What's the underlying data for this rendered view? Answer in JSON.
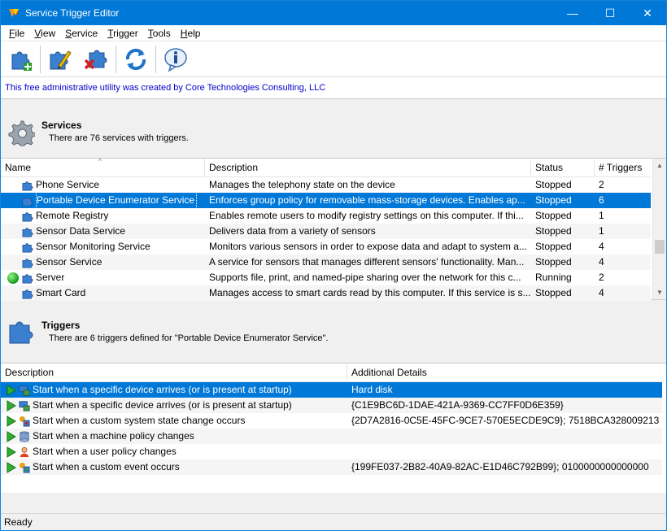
{
  "window": {
    "title": "Service Trigger Editor",
    "controls": {
      "minimize": "—",
      "maximize": "☐",
      "close": "✕"
    }
  },
  "menu": [
    {
      "label": "File",
      "key": "F",
      "rest": "ile"
    },
    {
      "label": "View",
      "key": "V",
      "rest": "iew"
    },
    {
      "label": "Service",
      "key": "S",
      "rest": "ervice"
    },
    {
      "label": "Trigger",
      "key": "T",
      "rest": "rigger"
    },
    {
      "label": "Tools",
      "key": "T",
      "rest": "ools"
    },
    {
      "label": "Help",
      "key": "H",
      "rest": "elp"
    }
  ],
  "toolbar": {
    "buttons": [
      {
        "name": "add-trigger-icon"
      },
      {
        "name": "edit-trigger-icon"
      },
      {
        "name": "delete-trigger-icon"
      },
      {
        "name": "refresh-icon"
      },
      {
        "name": "info-icon"
      }
    ]
  },
  "info_text": "This free administrative utility was created by Core Technologies Consulting, LLC",
  "services": {
    "title": "Services",
    "subtitle": "There are 76 services with triggers.",
    "columns": [
      "Name",
      "Description",
      "Status",
      "# Triggers"
    ],
    "rows": [
      {
        "name": "Phone Service",
        "description": "Manages the telephony state on the device",
        "status": "Stopped",
        "triggers": "2",
        "running": false,
        "selected": false
      },
      {
        "name": "Portable Device Enumerator Service",
        "description": "Enforces group policy for removable mass-storage devices. Enables ap...",
        "status": "Stopped",
        "triggers": "6",
        "running": false,
        "selected": true
      },
      {
        "name": "Remote Registry",
        "description": "Enables remote users to modify registry settings on this computer. If thi...",
        "status": "Stopped",
        "triggers": "1",
        "running": false,
        "selected": false
      },
      {
        "name": "Sensor Data Service",
        "description": "Delivers data from a variety of sensors",
        "status": "Stopped",
        "triggers": "1",
        "running": false,
        "selected": false
      },
      {
        "name": "Sensor Monitoring Service",
        "description": "Monitors various sensors in order to expose data and adapt to system a...",
        "status": "Stopped",
        "triggers": "4",
        "running": false,
        "selected": false
      },
      {
        "name": "Sensor Service",
        "description": "A service for sensors that manages different sensors' functionality. Man...",
        "status": "Stopped",
        "triggers": "4",
        "running": false,
        "selected": false
      },
      {
        "name": "Server",
        "description": "Supports file, print, and named-pipe sharing over the network for this c...",
        "status": "Running",
        "triggers": "2",
        "running": true,
        "selected": false
      },
      {
        "name": "Smart Card",
        "description": "Manages access to smart cards read by this computer. If this service is s...",
        "status": "Stopped",
        "triggers": "4",
        "running": false,
        "selected": false
      }
    ]
  },
  "triggers": {
    "title": "Triggers",
    "subtitle": "There are 6 triggers defined for \"Portable Device Enumerator Service\".",
    "columns": [
      "Description",
      "Additional Details"
    ],
    "rows": [
      {
        "description": "Start when a specific device arrives (or is present at startup)",
        "details": "Hard disk",
        "icon": "device-icon",
        "selected": true
      },
      {
        "description": "Start when a specific device arrives (or is present at startup)",
        "details": "{C1E9BC6D-1DAE-421A-9369-CC7FF0D6E359}",
        "icon": "device-icon",
        "selected": false
      },
      {
        "description": "Start when a custom system state change occurs",
        "details": "{2D7A2816-0C5E-45FC-9CE7-570E5ECDE9C9}; 7518BCA328009213",
        "icon": "custom-state-icon",
        "selected": false
      },
      {
        "description": "Start when a machine policy changes",
        "details": "",
        "icon": "machine-policy-icon",
        "selected": false
      },
      {
        "description": "Start when a user policy changes",
        "details": "",
        "icon": "user-policy-icon",
        "selected": false
      },
      {
        "description": "Start when a custom event occurs",
        "details": "{199FE037-2B82-40A9-82AC-E1D46C792B99}; 0100000000000000",
        "icon": "custom-event-icon",
        "selected": false
      }
    ]
  },
  "status_bar": "Ready",
  "colors": {
    "titlebar": "#0078d7",
    "selection": "#0078d7",
    "info_text": "#0000cc"
  }
}
